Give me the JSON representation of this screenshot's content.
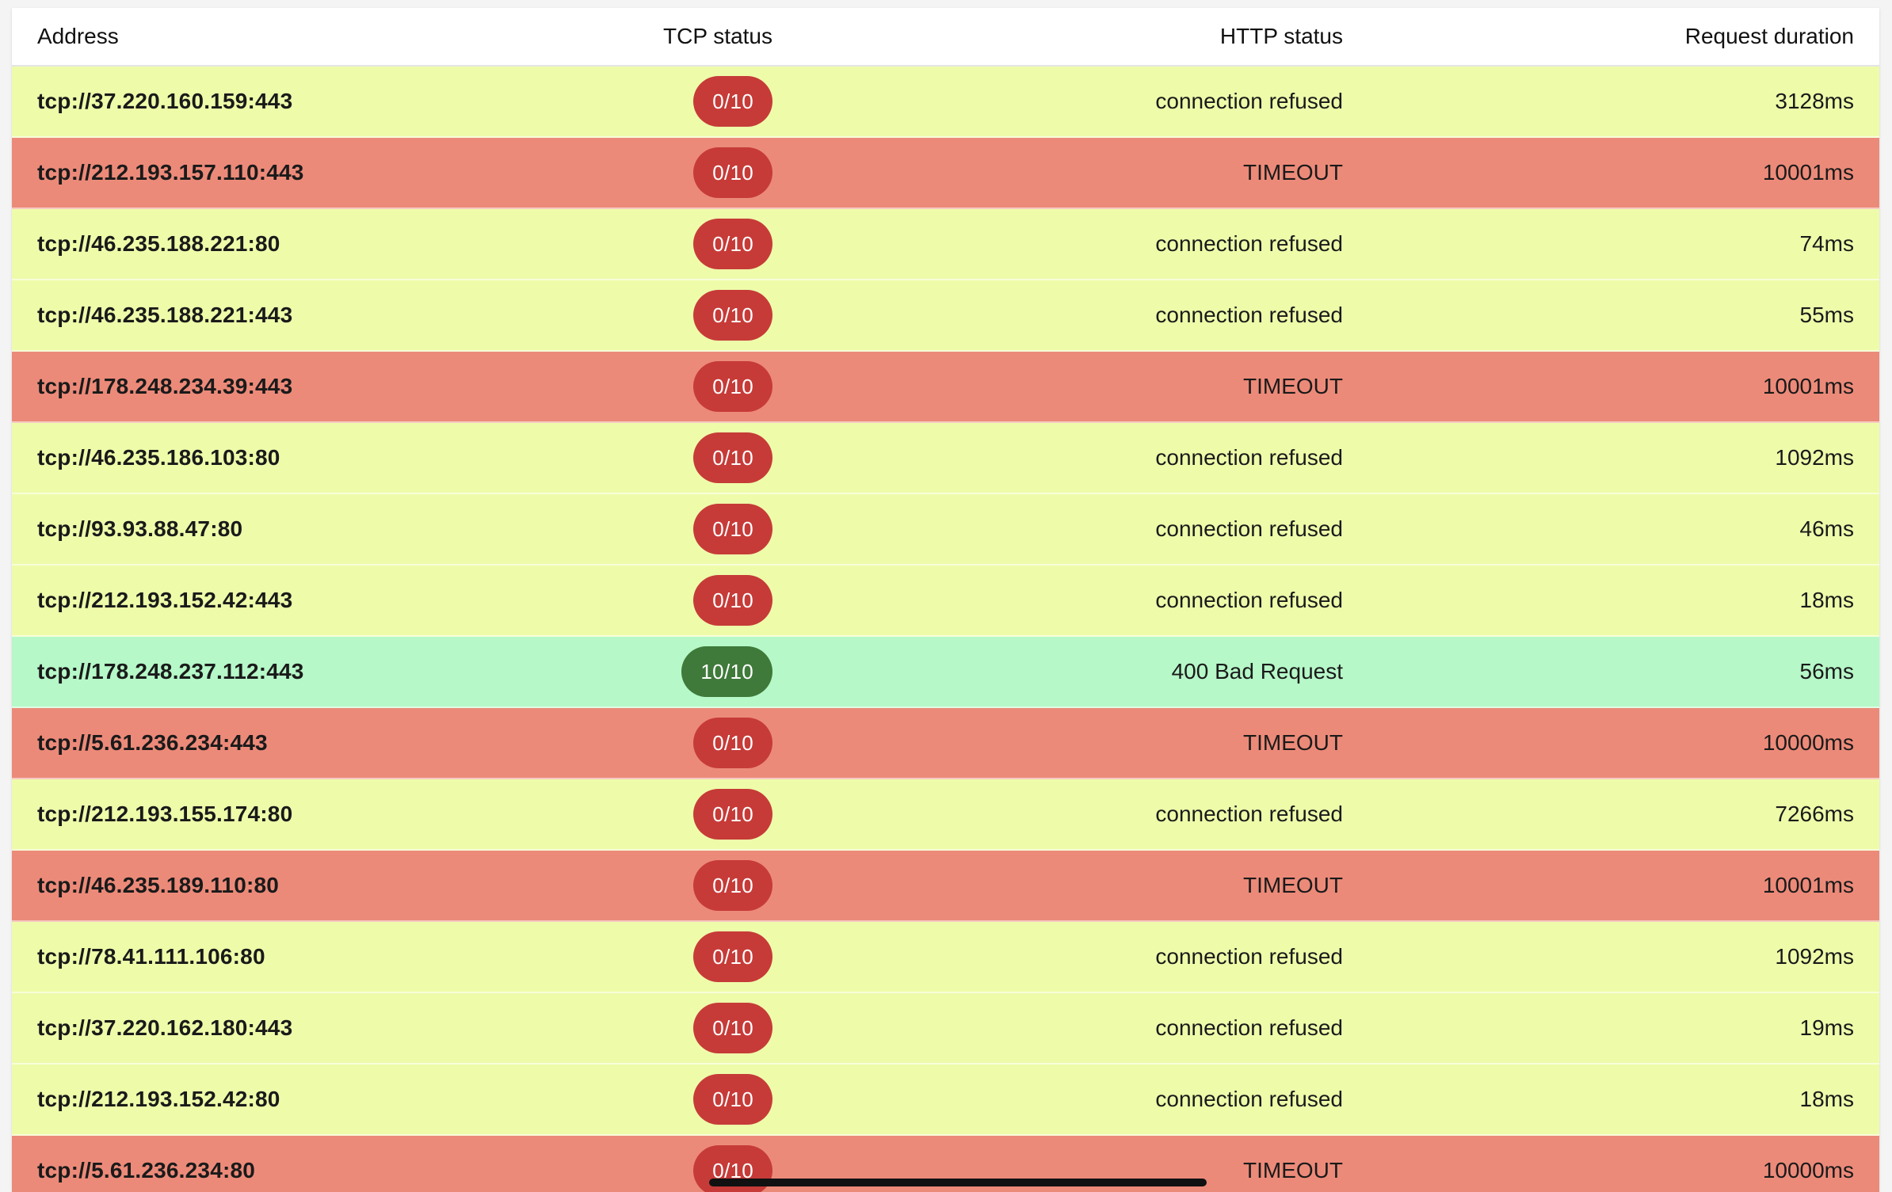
{
  "table": {
    "headers": {
      "address": "Address",
      "tcp_status": "TCP status",
      "http_status": "HTTP status",
      "duration": "Request duration"
    },
    "row_colors": {
      "refused": "#eefcaa",
      "timeout": "#ec8a79",
      "success": "#b6f8c8",
      "pill_fail": "#c63b38",
      "pill_ok": "#3f7a3a"
    },
    "rows": [
      {
        "address": "tcp://37.220.160.159:443",
        "tcp": "0/10",
        "http": "connection refused",
        "duration": "3128ms",
        "state": "refused"
      },
      {
        "address": "tcp://212.193.157.110:443",
        "tcp": "0/10",
        "http": "TIMEOUT",
        "duration": "10001ms",
        "state": "timeout"
      },
      {
        "address": "tcp://46.235.188.221:80",
        "tcp": "0/10",
        "http": "connection refused",
        "duration": "74ms",
        "state": "refused"
      },
      {
        "address": "tcp://46.235.188.221:443",
        "tcp": "0/10",
        "http": "connection refused",
        "duration": "55ms",
        "state": "refused"
      },
      {
        "address": "tcp://178.248.234.39:443",
        "tcp": "0/10",
        "http": "TIMEOUT",
        "duration": "10001ms",
        "state": "timeout"
      },
      {
        "address": "tcp://46.235.186.103:80",
        "tcp": "0/10",
        "http": "connection refused",
        "duration": "1092ms",
        "state": "refused"
      },
      {
        "address": "tcp://93.93.88.47:80",
        "tcp": "0/10",
        "http": "connection refused",
        "duration": "46ms",
        "state": "refused"
      },
      {
        "address": "tcp://212.193.152.42:443",
        "tcp": "0/10",
        "http": "connection refused",
        "duration": "18ms",
        "state": "refused"
      },
      {
        "address": "tcp://178.248.237.112:443",
        "tcp": "10/10",
        "http": "400 Bad Request",
        "duration": "56ms",
        "state": "success"
      },
      {
        "address": "tcp://5.61.236.234:443",
        "tcp": "0/10",
        "http": "TIMEOUT",
        "duration": "10000ms",
        "state": "timeout"
      },
      {
        "address": "tcp://212.193.155.174:80",
        "tcp": "0/10",
        "http": "connection refused",
        "duration": "7266ms",
        "state": "refused"
      },
      {
        "address": "tcp://46.235.189.110:80",
        "tcp": "0/10",
        "http": "TIMEOUT",
        "duration": "10001ms",
        "state": "timeout"
      },
      {
        "address": "tcp://78.41.111.106:80",
        "tcp": "0/10",
        "http": "connection refused",
        "duration": "1092ms",
        "state": "refused"
      },
      {
        "address": "tcp://37.220.162.180:443",
        "tcp": "0/10",
        "http": "connection refused",
        "duration": "19ms",
        "state": "refused"
      },
      {
        "address": "tcp://212.193.152.42:80",
        "tcp": "0/10",
        "http": "connection refused",
        "duration": "18ms",
        "state": "refused"
      },
      {
        "address": "tcp://5.61.236.234:80",
        "tcp": "0/10",
        "http": "TIMEOUT",
        "duration": "10000ms",
        "state": "timeout"
      }
    ]
  }
}
